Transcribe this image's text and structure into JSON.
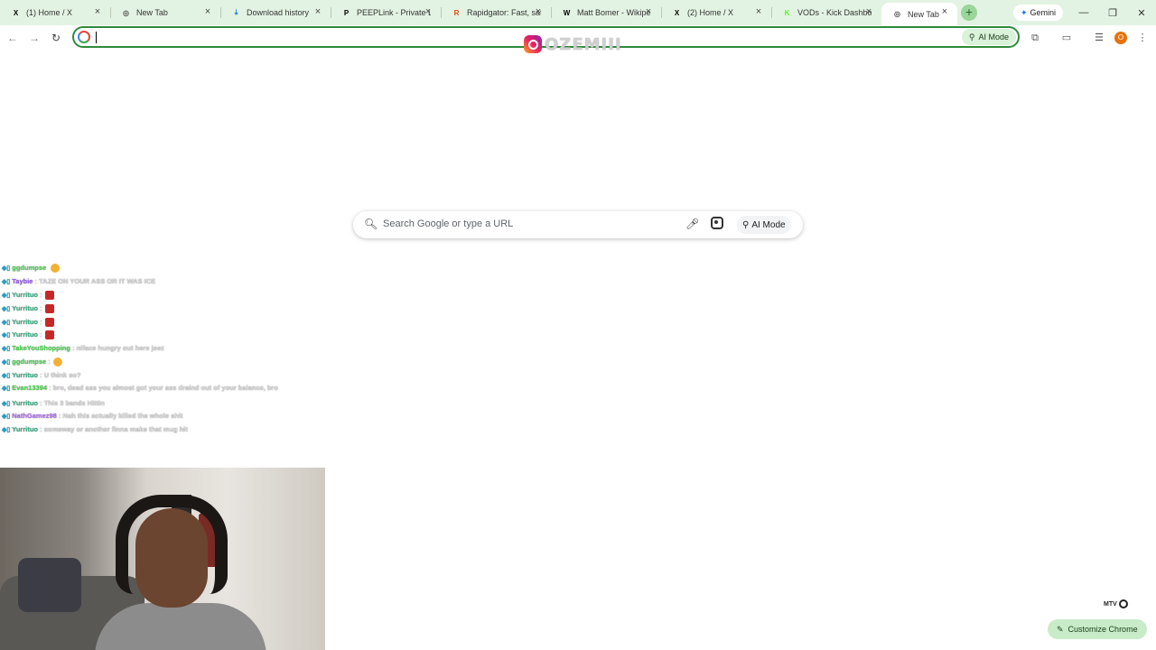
{
  "tabs": [
    {
      "label": "(1) Home / X",
      "icon": "x-logo-icon",
      "fav": "X",
      "fav_color": "#000000"
    },
    {
      "label": "New Tab",
      "icon": "chrome-icon",
      "fav": "◎",
      "fav_color": "#555555"
    },
    {
      "label": "Download history",
      "icon": "download-icon",
      "fav": "⤓",
      "fav_color": "#1a73e8"
    },
    {
      "label": "PEEPLink - Private Lin",
      "icon": "peeplink-icon",
      "fav": "P",
      "fav_color": "#000000"
    },
    {
      "label": "Rapidgator: Fast, safe",
      "icon": "rapidgator-icon",
      "fav": "R",
      "fav_color": "#d9480f"
    },
    {
      "label": "Matt Bomer - Wikipe",
      "icon": "wikipedia-icon",
      "fav": "W",
      "fav_color": "#000000"
    },
    {
      "label": "(2) Home / X",
      "icon": "x-logo-icon",
      "fav": "X",
      "fav_color": "#000000"
    },
    {
      "label": "VODs - Kick Dashboa",
      "icon": "kick-icon",
      "fav": "K",
      "fav_color": "#53fc18"
    },
    {
      "label": "New Tab",
      "icon": "chrome-icon",
      "fav": "◎",
      "fav_color": "#555555",
      "active": true
    }
  ],
  "new_tab_button": "+",
  "gemini_label": "Gemini",
  "omnibox": {
    "value": "",
    "ai_mode_label": "AI Mode"
  },
  "watermark_text": "OZEMIII",
  "search": {
    "placeholder": "Search Google or type a URL",
    "ai_mode_label": "AI Mode"
  },
  "chat": [
    {
      "user": "ggdumpse",
      "user_color": "#49d94f",
      "message": "",
      "emote": "face"
    },
    {
      "user": "Taybie",
      "user_color": "#9a5cf0",
      "message": ": TAZE ON YOUR ASS OR IT WAS ICE"
    },
    {
      "user": "Yurrituo",
      "user_color": "#3fb58a",
      "message": ":",
      "emote": "red"
    },
    {
      "user": "Yurrituo",
      "user_color": "#3fb58a",
      "message": ":",
      "emote": "red"
    },
    {
      "user": "Yurrituo",
      "user_color": "#3fb58a",
      "message": ":",
      "emote": "red"
    },
    {
      "user": "Yurrituo",
      "user_color": "#3fb58a",
      "message": ":",
      "emote": "red"
    },
    {
      "user": "TakeYouShopping",
      "user_color": "#49d94f",
      "message": ": niface hungry out here jeez"
    },
    {
      "user": "ggdumpse",
      "user_color": "#49d94f",
      "message": ":",
      "emote": "face"
    },
    {
      "user": "Yurrituo",
      "user_color": "#3fb58a",
      "message": ": U think so?"
    },
    {
      "user": "Evan13394",
      "user_color": "#49d94f",
      "message": ": bro, dead ass you almost got your ass draind out of your balance, bro"
    },
    {
      "user": "Yurrituo",
      "user_color": "#3fb58a",
      "message": ": This 3 bands Hittin"
    },
    {
      "user": "NathGamez98",
      "user_color": "#b26cf2",
      "message": ": Nah this actually killed the whole shit"
    },
    {
      "user": "Yurrituo",
      "user_color": "#3fb58a",
      "message": ": someway or another finna make that mug hit"
    }
  ],
  "logo_mark_text": "MTV",
  "customize_label": "Customize Chrome",
  "colors": {
    "accent_green": "#2f8a3a",
    "tab_bar": "#e3f3e3",
    "chip_green": "#c8ecc8"
  }
}
